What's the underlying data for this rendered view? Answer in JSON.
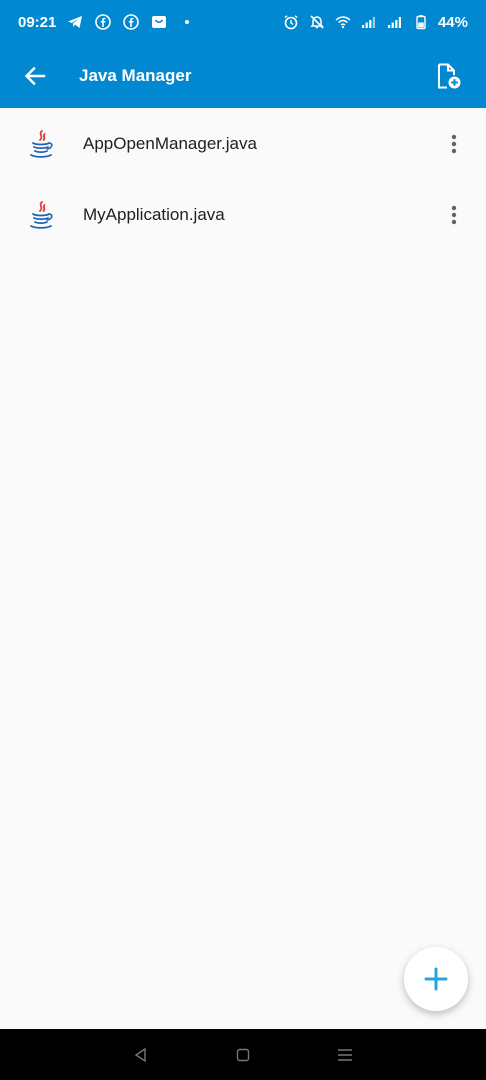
{
  "status_bar": {
    "time": "09:21",
    "battery": "44%",
    "left_icons": [
      "telegram-icon",
      "facebook-icon",
      "facebook-icon",
      "shopping-bag-icon",
      "dot-icon"
    ],
    "right_icons": [
      "alarm-icon",
      "mute-icon",
      "wifi-icon",
      "signal-icon",
      "signal-icon",
      "battery-icon"
    ]
  },
  "app_bar": {
    "title": "Java Manager",
    "back_icon": "arrow-left-icon",
    "action_icon": "new-file-icon"
  },
  "files": [
    {
      "name": "AppOpenManager.java",
      "icon": "java-icon"
    },
    {
      "name": "MyApplication.java",
      "icon": "java-icon"
    }
  ],
  "fab": {
    "icon": "plus-icon",
    "color": "#29a3e0"
  },
  "colors": {
    "primary": "#0288d1",
    "background": "#fafafa",
    "text": "#212121"
  },
  "nav_bar": [
    "back-triangle-icon",
    "home-square-icon",
    "menu-lines-icon"
  ]
}
